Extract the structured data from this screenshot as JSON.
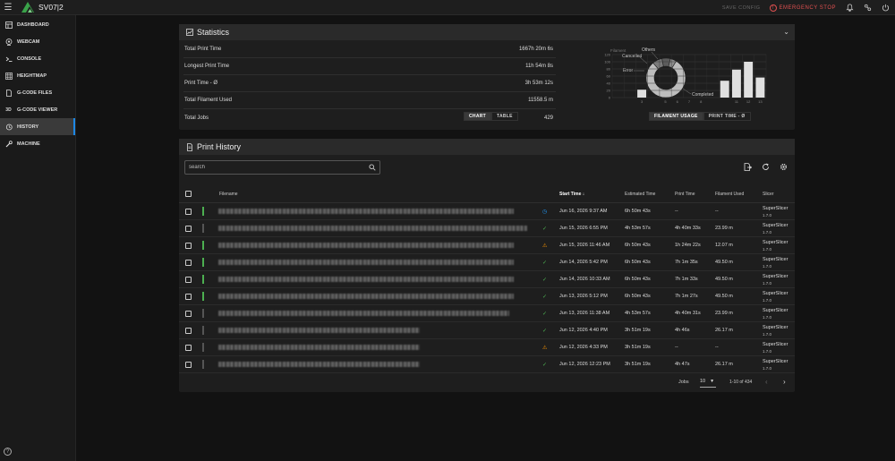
{
  "app": {
    "title": "SV07|2",
    "save_config": "SAVE CONFIG",
    "emergency_stop": "EMERGENCY STOP",
    "icons": [
      "menu-icon",
      "bell-icon",
      "settings-sliders-icon",
      "power-icon"
    ]
  },
  "sidebar": {
    "items": [
      {
        "label": "DASHBOARD",
        "icon": "dashboard-icon"
      },
      {
        "label": "WEBCAM",
        "icon": "webcam-icon"
      },
      {
        "label": "CONSOLE",
        "icon": "console-icon"
      },
      {
        "label": "HEIGHTMAP",
        "icon": "grid-icon"
      },
      {
        "label": "G-CODE FILES",
        "icon": "file-icon"
      },
      {
        "label": "G-CODE VIEWER",
        "icon": "3d-icon"
      },
      {
        "label": "HISTORY",
        "icon": "history-icon",
        "active": true
      },
      {
        "label": "MACHINE",
        "icon": "wrench-icon"
      }
    ]
  },
  "statistics": {
    "title": "Statistics",
    "rows": [
      {
        "label": "Total Print Time",
        "value": "1667h 20m 6s"
      },
      {
        "label": "Longest Print Time",
        "value": "11h 54m 8s"
      },
      {
        "label": "Print Time - Ø",
        "value": "3h 53m 12s"
      },
      {
        "label": "Total Filament Used",
        "value": "11558.5 m"
      },
      {
        "label": "Total Jobs",
        "value": "429"
      }
    ],
    "donut": {
      "labels": {
        "others": "Others",
        "cancelled": "Cancelled",
        "error": "Error",
        "completed": "Completed"
      },
      "values": {
        "completed": 80,
        "others": 5,
        "cancelled": 7,
        "error": 8
      }
    },
    "chart_toggle": {
      "chart": "CHART",
      "table": "TABLE"
    },
    "bar_toggle": {
      "filament_usage": "FILAMENT USAGE",
      "print_time": "PRINT TIME - Ø"
    }
  },
  "chart_data": {
    "type": "bar",
    "title": "Filament",
    "categories": [
      "3",
      "5",
      "6",
      "7",
      "8",
      "11",
      "12",
      "13"
    ],
    "values": [
      22,
      0,
      0,
      0,
      0,
      0,
      0,
      0
    ],
    "bars": [
      {
        "x": 3,
        "y": 22
      },
      {
        "x": 9,
        "y": 0
      },
      {
        "x": 10,
        "y": 47
      },
      {
        "x": 11,
        "y": 78
      },
      {
        "x": 12,
        "y": 100
      },
      {
        "x": 13,
        "y": 56
      }
    ],
    "xticks": [
      "3",
      "5",
      "6",
      "7",
      "8",
      "11",
      "12",
      "13"
    ],
    "yticks": [
      "0",
      "20",
      "40",
      "60",
      "80",
      "100",
      "120"
    ],
    "ylim": [
      0,
      120
    ]
  },
  "history": {
    "title": "Print History",
    "search_placeholder": "search",
    "columns": {
      "filename": "Filename",
      "start_time": "Start Time",
      "estimated": "Estimated Time",
      "print_time": "Print Time",
      "filament": "Filament Used",
      "slicer": "Slicer"
    },
    "rows": [
      {
        "status": "in-progress",
        "start": "Jun 16, 2026 9:37 AM",
        "est": "6h 50m 43s",
        "print": "--",
        "fil": "--",
        "slicer": "SuperSlicer",
        "ver": "1.7.0",
        "w": 330
      },
      {
        "status": "completed",
        "start": "Jun 15, 2026 6:55 PM",
        "est": "4h 53m 57s",
        "print": "4h 40m 33s",
        "fil": "23.99 m",
        "slicer": "SuperSlicer",
        "ver": "1.7.0",
        "w": 345
      },
      {
        "status": "cancelled",
        "start": "Jun 15, 2026 11:46 AM",
        "est": "6h 50m 43s",
        "print": "1h 24m 22s",
        "fil": "12.07 m",
        "slicer": "SuperSlicer",
        "ver": "1.7.0",
        "w": 330
      },
      {
        "status": "completed",
        "start": "Jun 14, 2026 5:42 PM",
        "est": "6h 50m 43s",
        "print": "7h 1m 35s",
        "fil": "49.50 m",
        "slicer": "SuperSlicer",
        "ver": "1.7.0",
        "w": 330
      },
      {
        "status": "completed",
        "start": "Jun 14, 2026 10:33 AM",
        "est": "6h 50m 43s",
        "print": "7h 1m 33s",
        "fil": "49.50 m",
        "slicer": "SuperSlicer",
        "ver": "1.7.0",
        "w": 330
      },
      {
        "status": "completed",
        "start": "Jun 13, 2026 5:12 PM",
        "est": "6h 50m 43s",
        "print": "7h 1m 27s",
        "fil": "49.50 m",
        "slicer": "SuperSlicer",
        "ver": "1.7.0",
        "w": 330
      },
      {
        "status": "completed",
        "start": "Jun 13, 2026 11:38 AM",
        "est": "4h 53m 57s",
        "print": "4h 40m 31s",
        "fil": "23.99 m",
        "slicer": "SuperSlicer",
        "ver": "1.7.0",
        "w": 325
      },
      {
        "status": "completed",
        "start": "Jun 12, 2026 4:40 PM",
        "est": "3h 51m 19s",
        "print": "4h 46s",
        "fil": "26.17 m",
        "slicer": "SuperSlicer",
        "ver": "1.7.0",
        "w": 225
      },
      {
        "status": "cancelled",
        "start": "Jun 12, 2026 4:33 PM",
        "est": "3h 51m 19s",
        "print": "--",
        "fil": "--",
        "slicer": "SuperSlicer",
        "ver": "1.7.0",
        "w": 225
      },
      {
        "status": "completed",
        "start": "Jun 12, 2026 12:23 PM",
        "est": "3h 51m 19s",
        "print": "4h 47s",
        "fil": "26.17 m",
        "slicer": "SuperSlicer",
        "ver": "1.7.0",
        "w": 225
      }
    ],
    "footer": {
      "jobs_label": "Jobs",
      "per_page": "10",
      "range": "1-10 of 434"
    }
  },
  "colors": {
    "accent": "#1e88e5",
    "completed": "#4caf50",
    "cancelled": "#ff9800",
    "error": "#e05050",
    "in_progress": "#2196f3"
  }
}
